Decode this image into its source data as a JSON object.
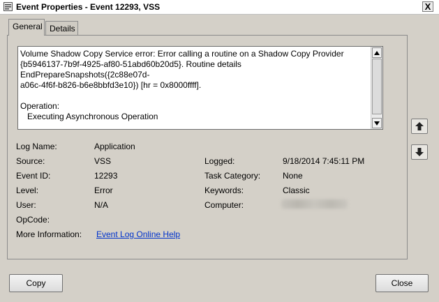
{
  "window": {
    "title": "Event Properties - Event 12293, VSS",
    "close_glyph": "X"
  },
  "tabs": [
    {
      "label": "General",
      "selected": true
    },
    {
      "label": "Details",
      "selected": false
    }
  ],
  "description": "Volume Shadow Copy Service error: Error calling a routine on a Shadow Copy Provider\n{b5946137-7b9f-4925-af80-51abd60b20d5}. Routine details EndPrepareSnapshots({2c88e07d-\na06c-4f6f-b826-b6e8bbfd3e10}) [hr = 0x8000ffff].\n\nOperation:\n   Executing Asynchronous Operation\n\nContext:",
  "fields": {
    "log_name": {
      "label": "Log Name:",
      "value": "Application"
    },
    "source": {
      "label": "Source:",
      "value": "VSS"
    },
    "event_id": {
      "label": "Event ID:",
      "value": "12293"
    },
    "level": {
      "label": "Level:",
      "value": "Error"
    },
    "user": {
      "label": "User:",
      "value": "N/A"
    },
    "opcode": {
      "label": "OpCode:",
      "value": ""
    },
    "more_info": {
      "label": "More Information:",
      "value": "Event Log Online Help"
    },
    "logged": {
      "label": "Logged:",
      "value": "9/18/2014 7:45:11 PM"
    },
    "task_category": {
      "label": "Task Category:",
      "value": "None"
    },
    "keywords": {
      "label": "Keywords:",
      "value": "Classic"
    },
    "computer": {
      "label": "Computer:",
      "value": ""
    }
  },
  "buttons": {
    "copy": "Copy",
    "close": "Close"
  },
  "colors": {
    "dialog_bg": "#d4d0c8",
    "link": "#0033cc"
  }
}
